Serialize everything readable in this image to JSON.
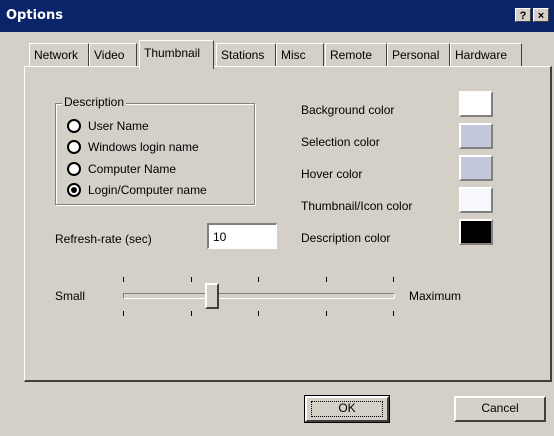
{
  "window": {
    "title": "Options",
    "help_glyph": "?",
    "close_glyph": "×"
  },
  "tabs": [
    {
      "label": "Network"
    },
    {
      "label": "Video"
    },
    {
      "label": "Thumbnail"
    },
    {
      "label": "Stations"
    },
    {
      "label": "Misc"
    },
    {
      "label": "Remote"
    },
    {
      "label": "Personal"
    },
    {
      "label": "Hardware"
    }
  ],
  "active_tab": "Thumbnail",
  "description_group": {
    "legend": "Description",
    "options": [
      {
        "label": "User Name",
        "selected": false
      },
      {
        "label": "Windows login name",
        "selected": false
      },
      {
        "label": "Computer Name",
        "selected": false
      },
      {
        "label": "Login/Computer name",
        "selected": true
      }
    ]
  },
  "refresh": {
    "label": "Refresh-rate (sec)",
    "value": "10"
  },
  "colors": [
    {
      "label": "Background color",
      "value": "#ffffff"
    },
    {
      "label": "Selection color",
      "value": "#c4c8dc"
    },
    {
      "label": "Hover color",
      "value": "#c4c8dc"
    },
    {
      "label": "Thumbnail/Icon color",
      "value": "#f8f8ff"
    },
    {
      "label": "Description color",
      "value": "#000000"
    }
  ],
  "slider": {
    "min_label": "Small",
    "max_label": "Maximum",
    "position_fraction": 0.33,
    "tick_count": 5
  },
  "buttons": {
    "ok": "OK",
    "cancel": "Cancel"
  }
}
